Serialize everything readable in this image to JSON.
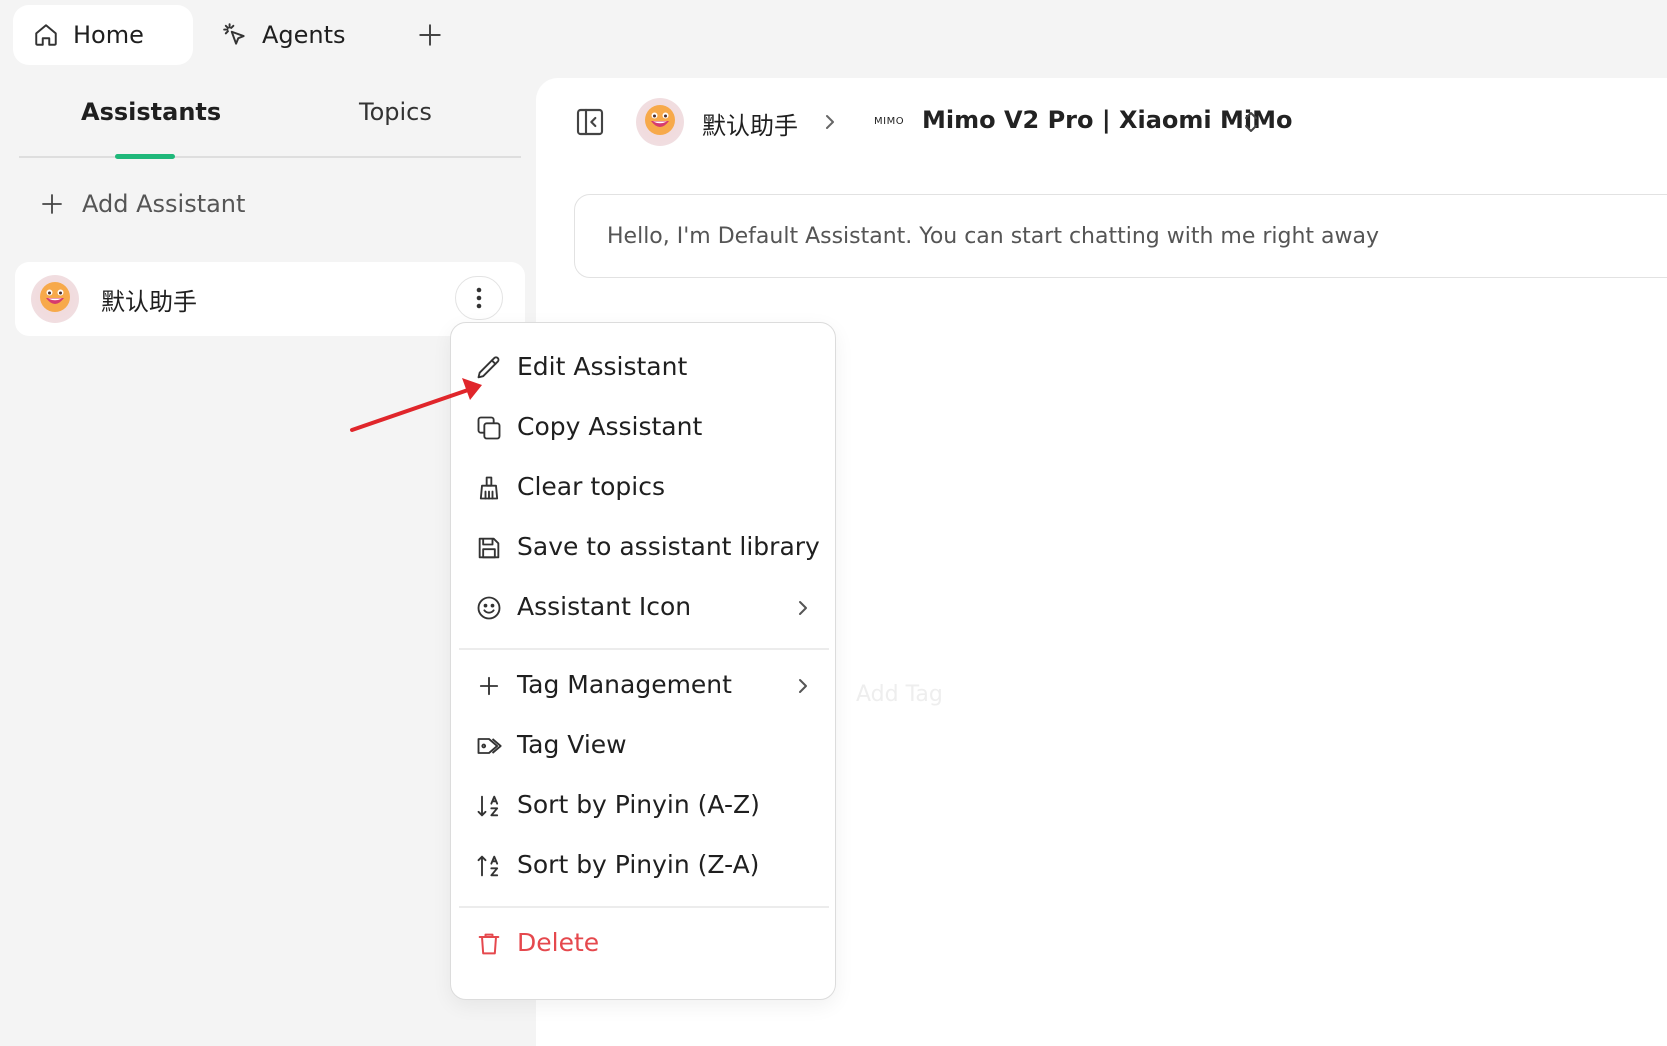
{
  "top_tabs": {
    "home_label": "Home",
    "agents_label": "Agents"
  },
  "sidebar": {
    "tabs": {
      "assistants": "Assistants",
      "topics": "Topics"
    },
    "add_assistant_label": "Add Assistant",
    "items": [
      {
        "name": "默认助手"
      }
    ]
  },
  "main": {
    "assistant_name": "默认助手",
    "model_logo_text": "MIMO",
    "model_name": "Mimo V2 Pro | Xiaomi MiMo",
    "welcome_text": "Hello, I'm Default Assistant. You can start chatting with me right away",
    "ghost_add_tag": "Add Tag"
  },
  "context_menu": {
    "edit": "Edit Assistant",
    "copy": "Copy Assistant",
    "clear": "Clear topics",
    "save": "Save to assistant library",
    "icon": "Assistant Icon",
    "tag_management": "Tag Management",
    "tag_view": "Tag View",
    "sort_az": "Sort by Pinyin (A-Z)",
    "sort_za": "Sort by Pinyin (Z-A)",
    "delete": "Delete"
  },
  "colors": {
    "accent": "#1fb87a",
    "danger": "#e5484d",
    "annotation_arrow": "#e0262b"
  }
}
